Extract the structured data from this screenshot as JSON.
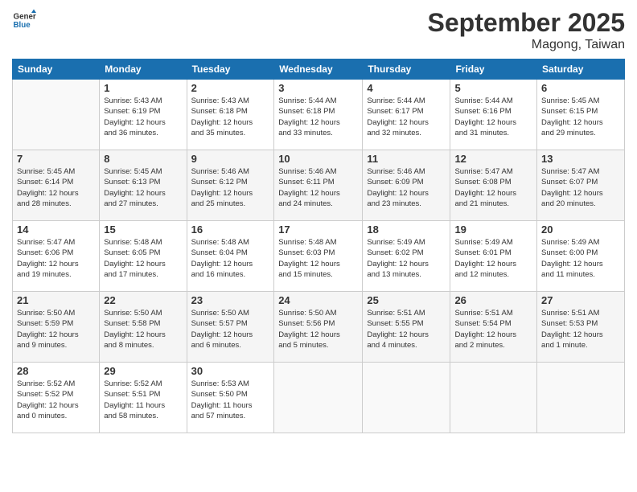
{
  "header": {
    "logo_line1": "General",
    "logo_line2": "Blue",
    "month": "September 2025",
    "location": "Magong, Taiwan"
  },
  "weekdays": [
    "Sunday",
    "Monday",
    "Tuesday",
    "Wednesday",
    "Thursday",
    "Friday",
    "Saturday"
  ],
  "weeks": [
    [
      {
        "day": "",
        "info": ""
      },
      {
        "day": "1",
        "info": "Sunrise: 5:43 AM\nSunset: 6:19 PM\nDaylight: 12 hours\nand 36 minutes."
      },
      {
        "day": "2",
        "info": "Sunrise: 5:43 AM\nSunset: 6:18 PM\nDaylight: 12 hours\nand 35 minutes."
      },
      {
        "day": "3",
        "info": "Sunrise: 5:44 AM\nSunset: 6:18 PM\nDaylight: 12 hours\nand 33 minutes."
      },
      {
        "day": "4",
        "info": "Sunrise: 5:44 AM\nSunset: 6:17 PM\nDaylight: 12 hours\nand 32 minutes."
      },
      {
        "day": "5",
        "info": "Sunrise: 5:44 AM\nSunset: 6:16 PM\nDaylight: 12 hours\nand 31 minutes."
      },
      {
        "day": "6",
        "info": "Sunrise: 5:45 AM\nSunset: 6:15 PM\nDaylight: 12 hours\nand 29 minutes."
      }
    ],
    [
      {
        "day": "7",
        "info": "Sunrise: 5:45 AM\nSunset: 6:14 PM\nDaylight: 12 hours\nand 28 minutes."
      },
      {
        "day": "8",
        "info": "Sunrise: 5:45 AM\nSunset: 6:13 PM\nDaylight: 12 hours\nand 27 minutes."
      },
      {
        "day": "9",
        "info": "Sunrise: 5:46 AM\nSunset: 6:12 PM\nDaylight: 12 hours\nand 25 minutes."
      },
      {
        "day": "10",
        "info": "Sunrise: 5:46 AM\nSunset: 6:11 PM\nDaylight: 12 hours\nand 24 minutes."
      },
      {
        "day": "11",
        "info": "Sunrise: 5:46 AM\nSunset: 6:09 PM\nDaylight: 12 hours\nand 23 minutes."
      },
      {
        "day": "12",
        "info": "Sunrise: 5:47 AM\nSunset: 6:08 PM\nDaylight: 12 hours\nand 21 minutes."
      },
      {
        "day": "13",
        "info": "Sunrise: 5:47 AM\nSunset: 6:07 PM\nDaylight: 12 hours\nand 20 minutes."
      }
    ],
    [
      {
        "day": "14",
        "info": "Sunrise: 5:47 AM\nSunset: 6:06 PM\nDaylight: 12 hours\nand 19 minutes."
      },
      {
        "day": "15",
        "info": "Sunrise: 5:48 AM\nSunset: 6:05 PM\nDaylight: 12 hours\nand 17 minutes."
      },
      {
        "day": "16",
        "info": "Sunrise: 5:48 AM\nSunset: 6:04 PM\nDaylight: 12 hours\nand 16 minutes."
      },
      {
        "day": "17",
        "info": "Sunrise: 5:48 AM\nSunset: 6:03 PM\nDaylight: 12 hours\nand 15 minutes."
      },
      {
        "day": "18",
        "info": "Sunrise: 5:49 AM\nSunset: 6:02 PM\nDaylight: 12 hours\nand 13 minutes."
      },
      {
        "day": "19",
        "info": "Sunrise: 5:49 AM\nSunset: 6:01 PM\nDaylight: 12 hours\nand 12 minutes."
      },
      {
        "day": "20",
        "info": "Sunrise: 5:49 AM\nSunset: 6:00 PM\nDaylight: 12 hours\nand 11 minutes."
      }
    ],
    [
      {
        "day": "21",
        "info": "Sunrise: 5:50 AM\nSunset: 5:59 PM\nDaylight: 12 hours\nand 9 minutes."
      },
      {
        "day": "22",
        "info": "Sunrise: 5:50 AM\nSunset: 5:58 PM\nDaylight: 12 hours\nand 8 minutes."
      },
      {
        "day": "23",
        "info": "Sunrise: 5:50 AM\nSunset: 5:57 PM\nDaylight: 12 hours\nand 6 minutes."
      },
      {
        "day": "24",
        "info": "Sunrise: 5:50 AM\nSunset: 5:56 PM\nDaylight: 12 hours\nand 5 minutes."
      },
      {
        "day": "25",
        "info": "Sunrise: 5:51 AM\nSunset: 5:55 PM\nDaylight: 12 hours\nand 4 minutes."
      },
      {
        "day": "26",
        "info": "Sunrise: 5:51 AM\nSunset: 5:54 PM\nDaylight: 12 hours\nand 2 minutes."
      },
      {
        "day": "27",
        "info": "Sunrise: 5:51 AM\nSunset: 5:53 PM\nDaylight: 12 hours\nand 1 minute."
      }
    ],
    [
      {
        "day": "28",
        "info": "Sunrise: 5:52 AM\nSunset: 5:52 PM\nDaylight: 12 hours\nand 0 minutes."
      },
      {
        "day": "29",
        "info": "Sunrise: 5:52 AM\nSunset: 5:51 PM\nDaylight: 11 hours\nand 58 minutes."
      },
      {
        "day": "30",
        "info": "Sunrise: 5:53 AM\nSunset: 5:50 PM\nDaylight: 11 hours\nand 57 minutes."
      },
      {
        "day": "",
        "info": ""
      },
      {
        "day": "",
        "info": ""
      },
      {
        "day": "",
        "info": ""
      },
      {
        "day": "",
        "info": ""
      }
    ]
  ]
}
